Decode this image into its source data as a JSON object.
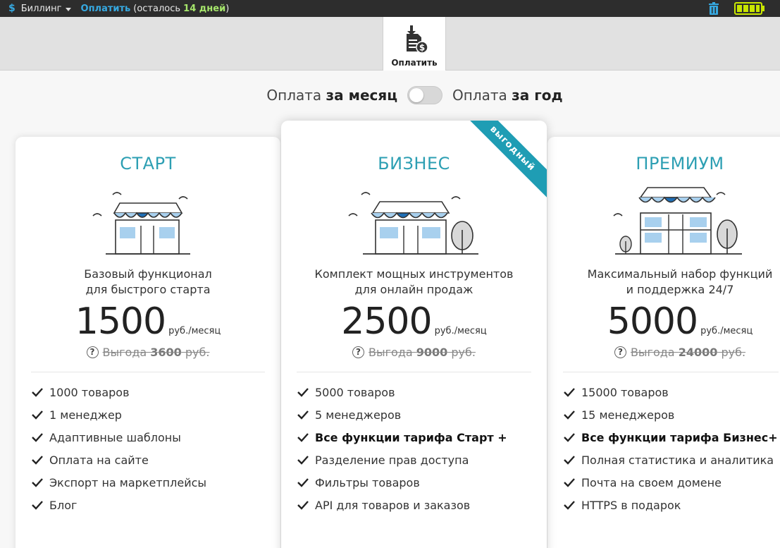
{
  "topbar": {
    "currency_icon": "$",
    "billing_label": "Биллинг",
    "pay_link": "Оплатить",
    "remaining_prefix": "(осталось ",
    "remaining_days": "14 дней",
    "remaining_suffix": ")",
    "accent_color": "#36a9e1",
    "days_color": "#a6e66b",
    "battery_color": "#c8e600"
  },
  "toolbar": {
    "pay_tab_label": "Оплатить"
  },
  "period_toggle": {
    "monthly_prefix": "Оплата ",
    "monthly_bold": "за месяц",
    "yearly_prefix": "Оплата ",
    "yearly_bold": "за год",
    "is_yearly": false
  },
  "plans": [
    {
      "title": "СТАРТ",
      "desc_line1": "Базовый функционал",
      "desc_line2": "для быстрого старта",
      "price": "1500",
      "unit": "руб./месяц",
      "savings_prefix": "Выгода ",
      "savings_value": "3600",
      "savings_suffix": " руб.",
      "features": [
        {
          "text": "1000 товаров",
          "bold": false
        },
        {
          "text": "1 менеджер",
          "bold": false
        },
        {
          "text": "Адаптивные шаблоны",
          "bold": false
        },
        {
          "text": "Оплата на сайте",
          "bold": false
        },
        {
          "text": "Экспорт на маркетплейсы",
          "bold": false
        },
        {
          "text": "Блог",
          "bold": false
        }
      ]
    },
    {
      "title": "БИЗНЕС",
      "ribbon": "выгодный",
      "desc_line1": "Комплект мощных инструментов",
      "desc_line2": "для онлайн продаж",
      "price": "2500",
      "unit": "руб./месяц",
      "savings_prefix": "Выгода ",
      "savings_value": "9000",
      "savings_suffix": " руб.",
      "features": [
        {
          "text": "5000 товаров",
          "bold": false
        },
        {
          "text": "5 менеджеров",
          "bold": false
        },
        {
          "text": "Все функции тарифа Старт +",
          "bold": true
        },
        {
          "text": "Разделение прав доступа",
          "bold": false
        },
        {
          "text": "Фильтры товаров",
          "bold": false
        },
        {
          "text": "API для товаров и заказов",
          "bold": false
        }
      ]
    },
    {
      "title": "ПРЕМИУМ",
      "desc_line1": "Максимальный набор функций",
      "desc_line2": "и поддержка 24/7",
      "price": "5000",
      "unit": "руб./месяц",
      "savings_prefix": "Выгода ",
      "savings_value": "24000",
      "savings_suffix": " руб.",
      "features": [
        {
          "text": "15000 товаров",
          "bold": false
        },
        {
          "text": "15 менеджеров",
          "bold": false
        },
        {
          "text": "Все функции тарифа Бизнес+",
          "bold": true
        },
        {
          "text": "Полная статистика и аналитика",
          "bold": false
        },
        {
          "text": "Почта на своем домене",
          "bold": false
        },
        {
          "text": "HTTPS в подарок",
          "bold": false
        }
      ]
    }
  ],
  "colors": {
    "plan_title": "#2d9fb3",
    "ribbon": "#1f9db4"
  }
}
